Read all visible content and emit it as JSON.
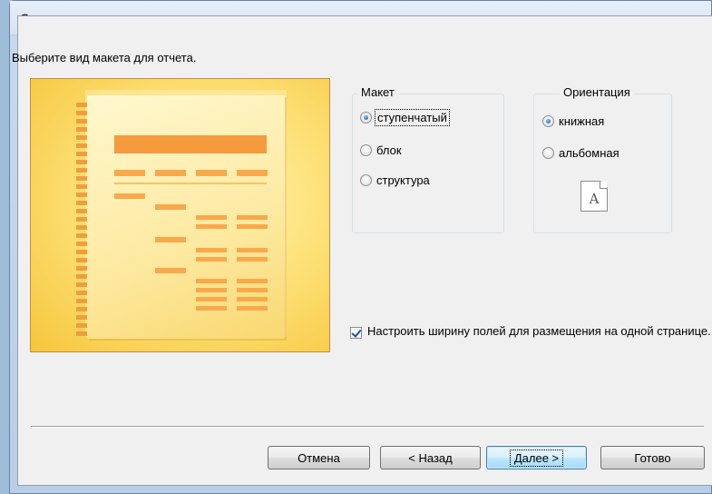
{
  "window": {
    "title": "Создание отчетов"
  },
  "prompt": "Выберите вид макета для отчета.",
  "layout_group": {
    "label": "Макет",
    "options": [
      {
        "label": "ступенчатый",
        "selected": true
      },
      {
        "label": "блок",
        "selected": false
      },
      {
        "label": "структура",
        "selected": false
      }
    ]
  },
  "orientation_group": {
    "label": "Ориентация",
    "options": [
      {
        "label": "книжная",
        "selected": true
      },
      {
        "label": "альбомная",
        "selected": false
      }
    ],
    "icon_letter": "A"
  },
  "fit_checkbox": {
    "label": "Настроить ширину полей для размещения на одной странице.",
    "checked": true
  },
  "buttons": {
    "cancel": "Отмена",
    "back": "< Назад",
    "next": "Далее >",
    "finish": "Готово"
  },
  "colors": {
    "preview_accent": "#f59b3d",
    "preview_background": "#fde27a",
    "default_button_border": "#3c7fb1"
  }
}
